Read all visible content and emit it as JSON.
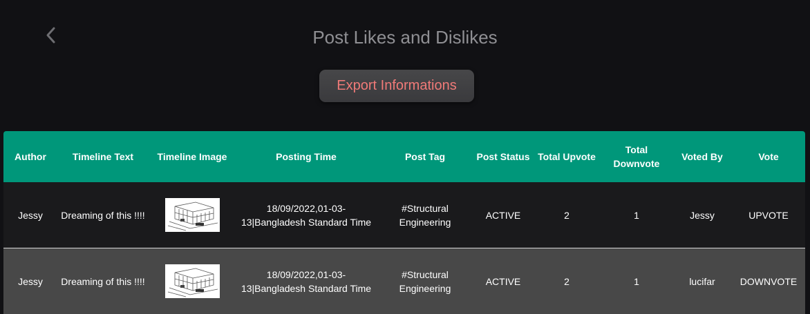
{
  "header": {
    "title": "Post Likes and Dislikes",
    "export_label": "Export Informations"
  },
  "colors": {
    "header_bg": "#00977a",
    "export_text": "#f07a78",
    "page_bg": "#111114"
  },
  "table": {
    "columns": [
      "Author",
      "Timeline Text",
      "Timeline Image",
      "Posting Time",
      "Post Tag",
      "Post Status",
      "Total Upvote",
      "Total Downvote",
      "Voted By",
      "Vote"
    ],
    "rows": [
      {
        "author": "Jessy",
        "timeline_text": "Dreaming of this !!!!",
        "timeline_image": "house-sketch-thumbnail",
        "posting_time": "18/09/2022,01-03-13|Bangladesh Standard Time",
        "post_tag": "#Structural Engineering",
        "post_status": "ACTIVE",
        "total_upvote": "2",
        "total_downvote": "1",
        "voted_by": "Jessy",
        "vote": "UPVOTE"
      },
      {
        "author": "Jessy",
        "timeline_text": "Dreaming of this !!!!",
        "timeline_image": "house-sketch-thumbnail",
        "posting_time": "18/09/2022,01-03-13|Bangladesh Standard Time",
        "post_tag": "#Structural Engineering",
        "post_status": "ACTIVE",
        "total_upvote": "2",
        "total_downvote": "1",
        "voted_by": "lucifar",
        "vote": "DOWNVOTE"
      }
    ]
  },
  "icons": {
    "back": "chevron-left-icon"
  }
}
